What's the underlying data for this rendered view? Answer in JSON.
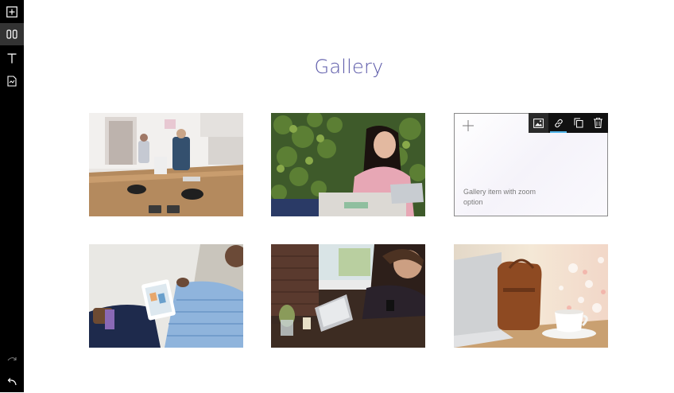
{
  "sidebar": {
    "items": [
      {
        "icon": "add-icon"
      },
      {
        "icon": "layout-columns-icon",
        "active": true
      },
      {
        "icon": "text-icon"
      },
      {
        "icon": "page-icon"
      }
    ],
    "bottom": [
      {
        "icon": "redo-icon"
      },
      {
        "icon": "undo-icon"
      }
    ]
  },
  "section": {
    "title": "Gallery"
  },
  "gallery": {
    "items": [
      {
        "alt": "office-table-photo"
      },
      {
        "alt": "woman-on-phone-photo"
      },
      {
        "caption": "Gallery item with zoom option",
        "empty": true
      },
      {
        "alt": "tablet-on-lap-photo"
      },
      {
        "alt": "man-at-laptop-photo"
      },
      {
        "alt": "laptop-and-cup-photo"
      }
    ],
    "toolbar": {
      "buttons": [
        "image-icon",
        "link-icon",
        "duplicate-icon",
        "trash-icon"
      ],
      "active_underline": "link-icon"
    }
  },
  "colors": {
    "title": "#5a58a8",
    "sidebar": "#000000",
    "toolbar": "#111111",
    "accent": "#4fb3e8"
  }
}
